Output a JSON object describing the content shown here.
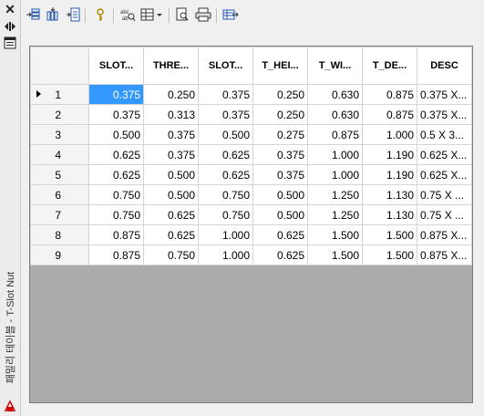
{
  "sidebar": {
    "close_icon": "close-icon",
    "dock_icon": "dock-icon",
    "properties_icon": "properties-icon",
    "title": "패밀리 테이블 - T-Slot Nut"
  },
  "toolbar": {
    "buttons": [
      "insert-rows-icon",
      "insert-columns-icon",
      "add-parameter-icon",
      "key-icon",
      "find-replace-icon",
      "table-view-icon",
      "preview-icon",
      "print-icon",
      "export-icon"
    ]
  },
  "table": {
    "columns": [
      "SLOT...",
      "THRE...",
      "SLOT...",
      "T_HEI...",
      "T_WI...",
      "T_DE...",
      "DESC"
    ],
    "rows": [
      {
        "num": "1",
        "cells": [
          "0.375",
          "0.250",
          "0.375",
          "0.250",
          "0.630",
          "0.875",
          "0.375 X..."
        ]
      },
      {
        "num": "2",
        "cells": [
          "0.375",
          "0.313",
          "0.375",
          "0.250",
          "0.630",
          "0.875",
          "0.375 X..."
        ]
      },
      {
        "num": "3",
        "cells": [
          "0.500",
          "0.375",
          "0.500",
          "0.275",
          "0.875",
          "1.000",
          "0.5 X 3..."
        ]
      },
      {
        "num": "4",
        "cells": [
          "0.625",
          "0.375",
          "0.625",
          "0.375",
          "1.000",
          "1.190",
          "0.625 X..."
        ]
      },
      {
        "num": "5",
        "cells": [
          "0.625",
          "0.500",
          "0.625",
          "0.375",
          "1.000",
          "1.190",
          "0.625 X..."
        ]
      },
      {
        "num": "6",
        "cells": [
          "0.750",
          "0.500",
          "0.750",
          "0.500",
          "1.250",
          "1.130",
          "0.75 X ..."
        ]
      },
      {
        "num": "7",
        "cells": [
          "0.750",
          "0.625",
          "0.750",
          "0.500",
          "1.250",
          "1.130",
          "0.75 X ..."
        ]
      },
      {
        "num": "8",
        "cells": [
          "0.875",
          "0.625",
          "1.000",
          "0.625",
          "1.500",
          "1.500",
          "0.875 X..."
        ]
      },
      {
        "num": "9",
        "cells": [
          "0.875",
          "0.750",
          "1.000",
          "0.625",
          "1.500",
          "1.500",
          "0.875 X..."
        ]
      }
    ],
    "selected_row": 0,
    "selected_col": 0
  },
  "colors": {
    "selection": "#3399ff",
    "empty_area": "#ababab"
  }
}
